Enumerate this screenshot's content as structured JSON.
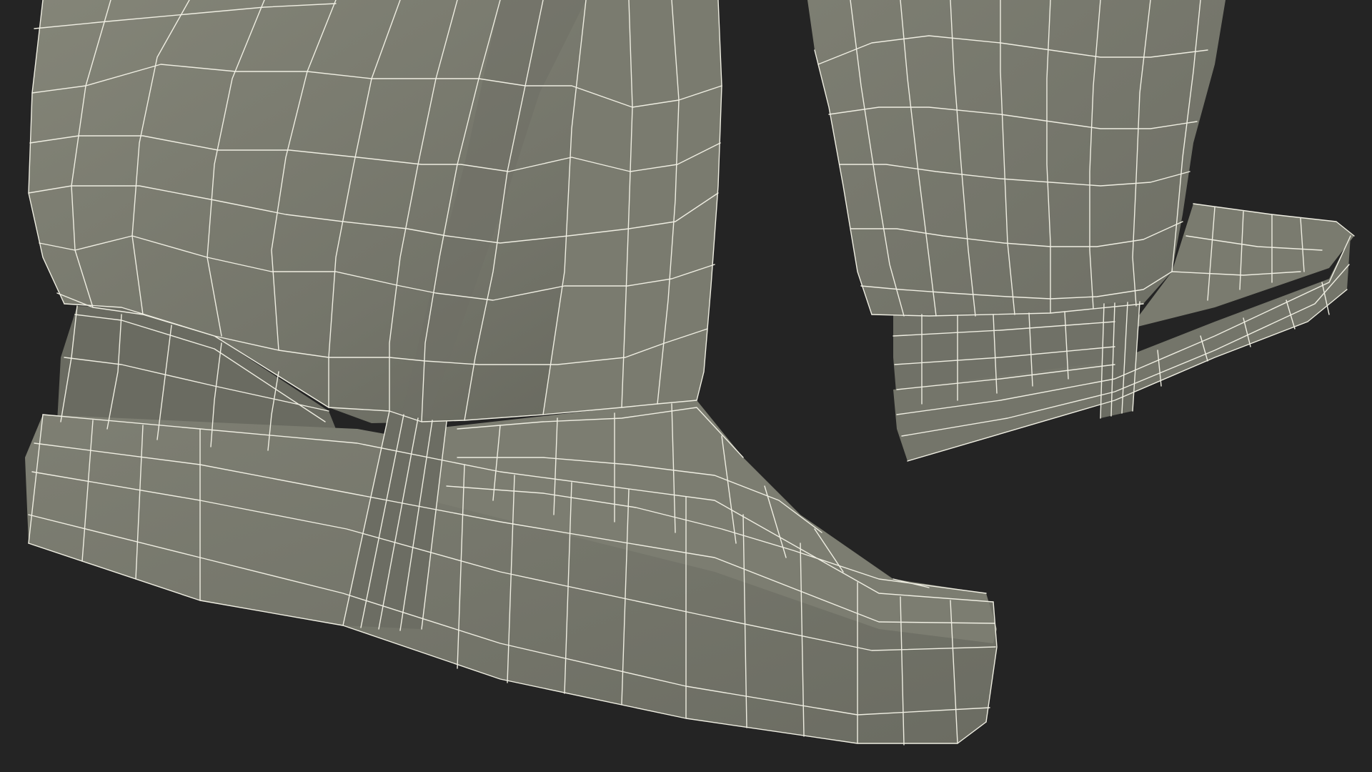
{
  "scene": {
    "subject": "wireframe-render-trouser-legs-and-shoes",
    "colors": {
      "background": "#242424",
      "surface": "#7b7c70",
      "surface_shadow": "#5f6057",
      "surface_highlight": "#8a8b7f",
      "wire": "#efeee2"
    }
  }
}
